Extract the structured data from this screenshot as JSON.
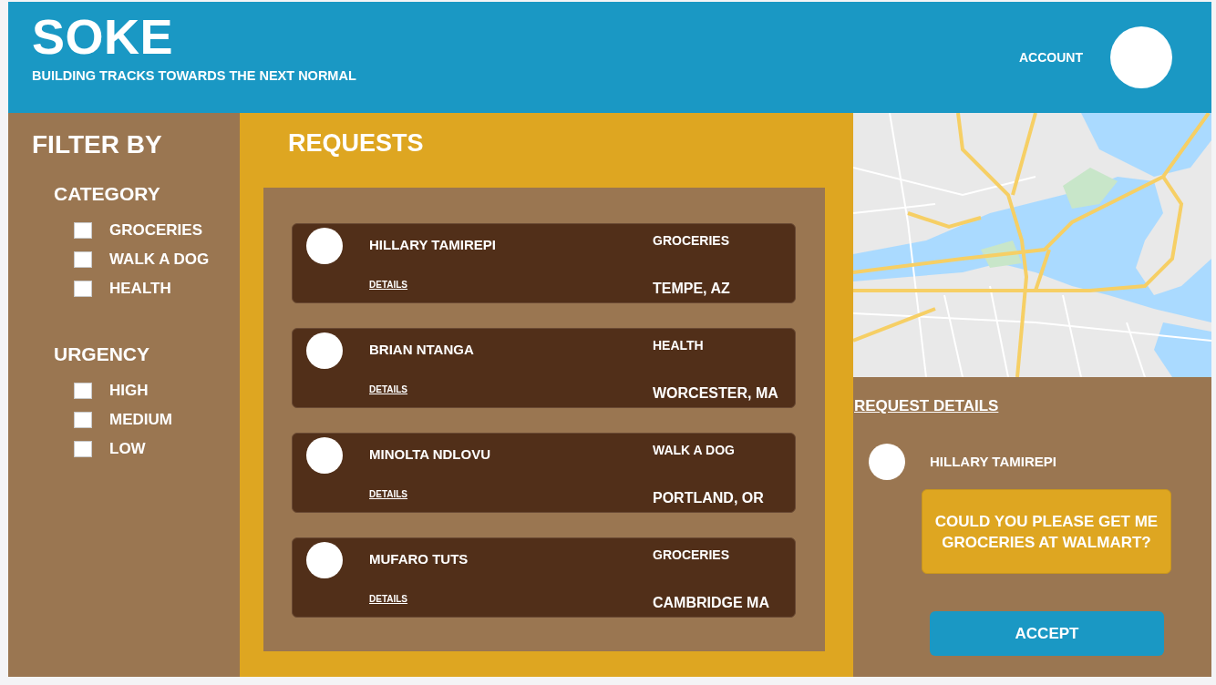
{
  "header": {
    "logo": "SOKE",
    "tagline": "BUILDING TRACKS TOWARDS THE NEXT NORMAL",
    "account_label": "ACCOUNT"
  },
  "filter": {
    "title": "FILTER BY",
    "sections": [
      {
        "title": "CATEGORY",
        "options": [
          {
            "label": "GROCERIES",
            "checked": false
          },
          {
            "label": "WALK A DOG",
            "checked": false
          },
          {
            "label": "HEALTH",
            "checked": false
          }
        ]
      },
      {
        "title": "URGENCY",
        "options": [
          {
            "label": "HIGH",
            "checked": false
          },
          {
            "label": "MEDIUM",
            "checked": false
          },
          {
            "label": "LOW",
            "checked": false
          }
        ]
      }
    ]
  },
  "requests": {
    "title": "REQUESTS",
    "items": [
      {
        "name": "HILLARY TAMIREPI",
        "details_link": "DETAILS",
        "category": "GROCERIES",
        "location": "TEMPE, AZ"
      },
      {
        "name": "BRIAN NTANGA",
        "details_link": "DETAILS",
        "category": "HEALTH",
        "location": "WORCESTER, MA"
      },
      {
        "name": "MINOLTA NDLOVU",
        "details_link": "DETAILS",
        "category": "WALK A DOG",
        "location": "PORTLAND, OR"
      },
      {
        "name": "MUFARO TUTS",
        "details_link": "DETAILS",
        "category": "GROCERIES",
        "location": "CAMBRIDGE MA"
      }
    ]
  },
  "request_details": {
    "title": "REQUEST DETAILS",
    "name": "HILLARY TAMIREPI",
    "message": "COULD YOU PLEASE GET ME GROCERIES AT WALMART?",
    "button": "ACCEPT"
  }
}
